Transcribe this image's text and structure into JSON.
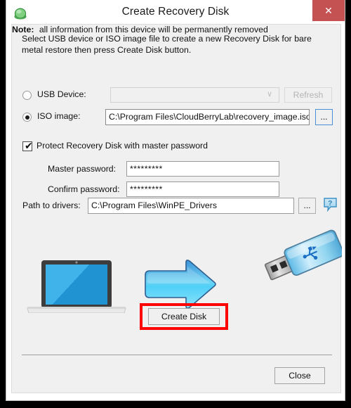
{
  "window": {
    "title": "Create Recovery Disk",
    "app_icon": "green-orb-icon",
    "close_icon": "close-icon",
    "close_icon_glyph": "✕",
    "close_button_color": "#c45252"
  },
  "body": {
    "intro_text": "Select USB device or ISO image file to create a new Recovery Disk for bare metal restore then press Create Disk button.",
    "note_label": "Note:",
    "note_text": "all information from this device will be permanently removed"
  },
  "source": {
    "usb": {
      "label": "USB Device:",
      "selected": false,
      "combo_value": "",
      "combo_placeholder": "",
      "combo_disabled": true,
      "chevron_icon": "chevron-down-icon",
      "chevron_glyph": "∨",
      "refresh_label": "Refresh",
      "refresh_disabled": true
    },
    "iso": {
      "label": "ISO image:",
      "selected": true,
      "path_value": "C:\\Program Files\\CloudBerryLab\\recovery_image.iso",
      "browse_label": "...",
      "browse_icon": "ellipsis-browse-icon"
    }
  },
  "protection": {
    "checkbox_label": "Protect Recovery Disk with master password",
    "checked": true,
    "check_glyph": "✔",
    "master_password_label": "Master password:",
    "master_password_value": "*********",
    "confirm_password_label": "Confirm password:",
    "confirm_password_value": "*********"
  },
  "drivers": {
    "label": "Path to drivers:",
    "path_value": "C:\\Program Files\\WinPE_Drivers",
    "browse_label": "...",
    "help_icon": "help-question-bubble-icon",
    "help_glyph": "?"
  },
  "illustration": {
    "laptop_icon": "laptop-icon",
    "arrow_icon": "right-arrow-icon",
    "usb_drive_icon": "usb-flash-drive-icon",
    "laptop_screen_color": "#2ba7e4",
    "arrow_color": "#39c4f2",
    "usb_body_color": "#8fd4ef"
  },
  "actions": {
    "create_disk_label": "Create Disk",
    "create_disk_highlighted": true,
    "highlight_color": "#fe0000",
    "close_label": "Close"
  }
}
